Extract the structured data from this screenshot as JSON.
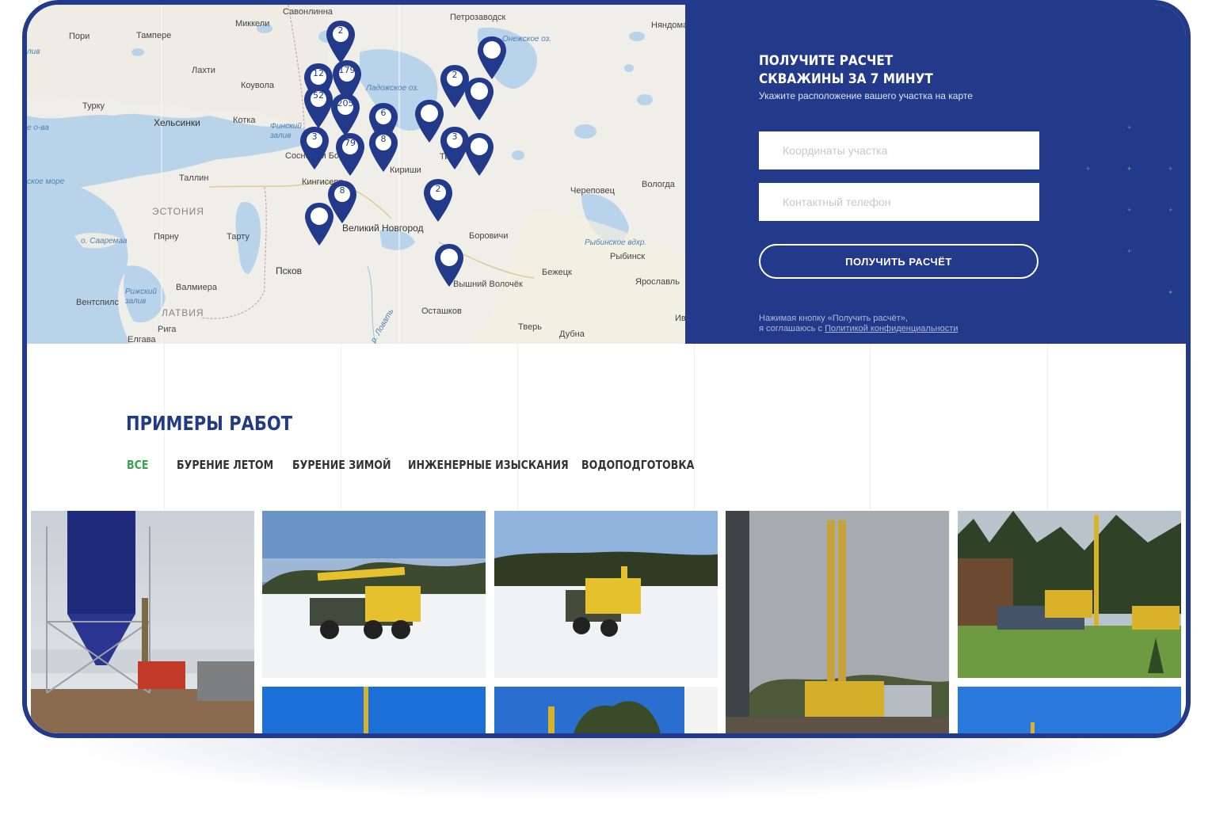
{
  "map": {
    "cities": [
      {
        "name": "Савонлинна"
      },
      {
        "name": "Петрозаводск"
      },
      {
        "name": "Тампере"
      },
      {
        "name": "Миккели"
      },
      {
        "name": "Пори"
      },
      {
        "name": "Няндома"
      },
      {
        "name": "Лахти"
      },
      {
        "name": "Коувола"
      },
      {
        "name": "Турку"
      },
      {
        "name": "Хельсинки"
      },
      {
        "name": "Котка"
      },
      {
        "name": "Таллин"
      },
      {
        "name": "Кингисепп"
      },
      {
        "name": "Кириши"
      },
      {
        "name": "Череповец"
      },
      {
        "name": "Вологда"
      },
      {
        "name": "ЭСТОНИЯ"
      },
      {
        "name": "Пярну"
      },
      {
        "name": "Тарту"
      },
      {
        "name": "Великий Новгород"
      },
      {
        "name": "Боровичи"
      },
      {
        "name": "Рыбинск"
      },
      {
        "name": "Псков"
      },
      {
        "name": "Бежецк"
      },
      {
        "name": "Ярославль"
      },
      {
        "name": "Валмиера"
      },
      {
        "name": "Вентспилс"
      },
      {
        "name": "ЛАТВИЯ"
      },
      {
        "name": "Рига"
      },
      {
        "name": "Осташков"
      },
      {
        "name": "Тверь"
      },
      {
        "name": "Дубна"
      },
      {
        "name": "Елгава"
      },
      {
        "name": "Вышний Волочёк"
      },
      {
        "name": "Сосновый Бор"
      },
      {
        "name": "Ив"
      },
      {
        "name": "Ти"
      }
    ],
    "water": [
      "Ладожское оз.",
      "Онежское оз.",
      "Финский залив",
      "Рижский залив",
      "Рыбинское вдхр.",
      "р. Ловать",
      "ское море",
      "е о-ва",
      "о. Сааремаа",
      "лив"
    ],
    "pins": [
      "2",
      "12",
      "179",
      "52",
      "205",
      "6",
      "3",
      "79",
      "8",
      "8",
      "2",
      "3",
      "2",
      "",
      "",
      "",
      "",
      "",
      ""
    ]
  },
  "form": {
    "title_line1": "ПОЛУЧИТЕ РАСЧЕТ",
    "title_line2": "СКВАЖИНЫ ЗА 7 МИНУТ",
    "subtitle": "Укажите расположение вашего участка на карте",
    "coords_placeholder": "Координаты участка",
    "phone_placeholder": "Контактный телефон",
    "submit_label": "ПОЛУЧИТЬ РАСЧЁТ",
    "consent_line1": "Нажимая кнопку «Получить расчёт»,",
    "consent_line2": "я соглашаюсь с ",
    "consent_link": "Политикой конфиденциальности"
  },
  "works": {
    "heading": "ПРИМЕРЫ РАБОТ",
    "tabs": [
      "ВСЕ",
      "БУРЕНИЕ ЛЕТОМ",
      "БУРЕНИЕ ЗИМОЙ",
      "ИНЖЕНЕРНЫЕ ИЗЫСКАНИЯ",
      "ВОДОПОДГОТОВКА"
    ],
    "photos": [
      "silo-rig-photo",
      "winter-truck-photo-1",
      "winter-truck-photo-2",
      "tall-rig-photo",
      "summer-rig-photo",
      "blue-sky-photo-1",
      "blue-sky-photo-2",
      "blue-sky-photo-3"
    ]
  },
  "colors": {
    "brand": "#233a8a",
    "accent": "#3aa453",
    "map_water": "#b8d4ea",
    "map_land": "#ecebe5"
  }
}
